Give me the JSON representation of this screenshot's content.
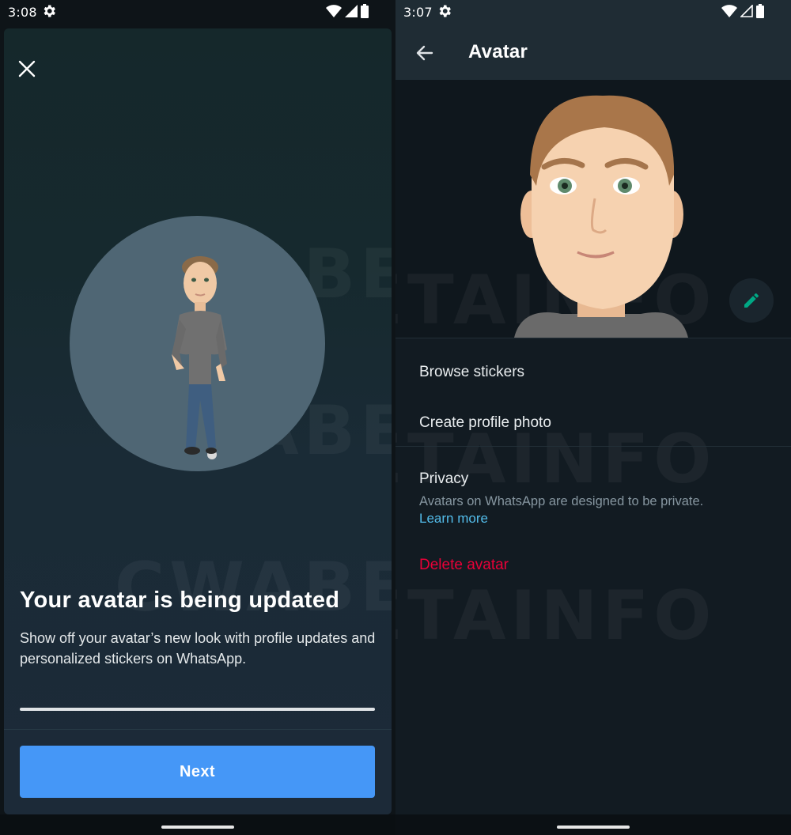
{
  "left_screen": {
    "status": {
      "time": "3:08"
    },
    "title": "Your avatar is being updated",
    "subtitle": "Show off your avatar’s new look with profile updates and personalized stickers on WhatsApp.",
    "progress": 1.0,
    "next_label": "Next"
  },
  "right_screen": {
    "status": {
      "time": "3:07"
    },
    "appbar_title": "Avatar",
    "menu": {
      "browse_stickers": "Browse stickers",
      "create_profile_photo": "Create profile photo",
      "privacy_title": "Privacy",
      "privacy_desc": "Avatars on WhatsApp are designed to be private.",
      "learn_more": "Learn more",
      "delete_avatar": "Delete avatar"
    }
  },
  "watermark": "CWABETAINFO",
  "colors": {
    "accent_blue": "#4597f7",
    "edit_green": "#00a884",
    "link_blue": "#53bdeb",
    "danger_red": "#ea0038"
  },
  "icons": [
    "close-icon",
    "back-arrow-icon",
    "pencil-icon",
    "wifi-icon",
    "signal-icon",
    "battery-icon",
    "gear-icon"
  ]
}
